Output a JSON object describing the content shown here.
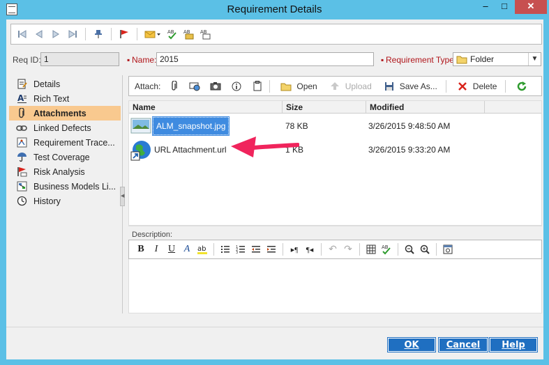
{
  "window": {
    "title": "Requirement Details",
    "minimize": "–",
    "maximize": "□",
    "close": "✕"
  },
  "toolbar": {
    "icons": [
      "first-record-icon",
      "previous-record-icon",
      "next-record-icon",
      "last-record-icon",
      "pin-icon",
      "flag-icon",
      "email-icon",
      "spell-check-icon",
      "spelling-options-icon",
      "thesaurus-icon"
    ]
  },
  "fields": {
    "req_id_label": "Req ID:",
    "req_id_value": "1",
    "name_label": "Name:",
    "name_value": "2015",
    "type_label": "Requirement Type:",
    "type_value": "Folder"
  },
  "nav": {
    "items": [
      {
        "label": "Details",
        "icon": "details-icon"
      },
      {
        "label": "Rich Text",
        "icon": "rich-text-icon"
      },
      {
        "label": "Attachments",
        "icon": "paperclip-icon",
        "active": true
      },
      {
        "label": "Linked Defects",
        "icon": "link-icon"
      },
      {
        "label": "Requirement Trace...",
        "icon": "trace-icon"
      },
      {
        "label": "Test Coverage",
        "icon": "umbrella-icon"
      },
      {
        "label": "Risk Analysis",
        "icon": "risk-icon"
      },
      {
        "label": "Business Models Li...",
        "icon": "business-model-icon"
      },
      {
        "label": "History",
        "icon": "history-icon"
      }
    ]
  },
  "attach_bar": {
    "attach_label": "Attach:",
    "open": "Open",
    "upload": "Upload",
    "save_as": "Save As...",
    "delete": "Delete"
  },
  "grid": {
    "columns": [
      "Name",
      "Size",
      "Modified"
    ],
    "rows": [
      {
        "name": "ALM_snapshot.jpg",
        "size": "78 KB",
        "modified": "3/26/2015 9:48:50 AM",
        "icon": "image-file-icon",
        "selected": true
      },
      {
        "name": "URL Attachment.url",
        "size": "1 KB",
        "modified": "3/26/2015 9:33:20 AM",
        "icon": "url-globe-icon"
      }
    ]
  },
  "description": {
    "label": "Description:"
  },
  "buttons": {
    "ok": "OK",
    "cancel": "Cancel",
    "help": "Help"
  },
  "colors": {
    "title_bar": "#5bc0e6",
    "active_nav": "#f9c98f",
    "selection": "#3f8be0",
    "dialog_button": "#1f6fc1",
    "annotation_arrow": "#f0245c"
  }
}
